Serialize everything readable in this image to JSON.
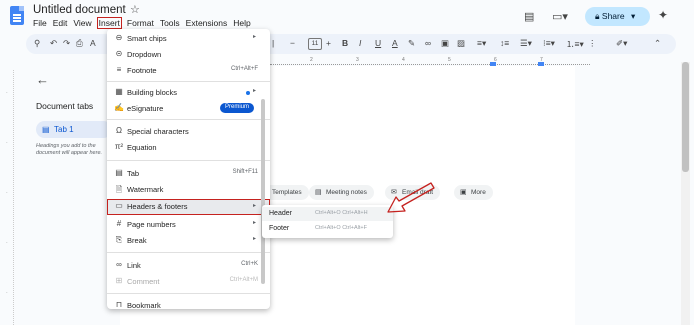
{
  "titlebar": {
    "doc_title": "Untitled document",
    "star_icon": "star-icon",
    "share_label": "Share",
    "share_icon": "lock-icon",
    "right_icons": [
      "comments-icon",
      "meet-icon",
      "gemini-spark-icon"
    ]
  },
  "menubar": {
    "items": [
      "File",
      "Edit",
      "View",
      "Insert",
      "Format",
      "Tools",
      "Extensions",
      "Help"
    ],
    "active": "Insert"
  },
  "toolbar": {
    "font_size": "11",
    "icons": [
      "search-icon",
      "undo-icon",
      "redo-icon",
      "print-icon",
      "spellcheck-icon",
      "decrease-font-size-icon",
      "increase-font-size-icon",
      "bold-icon",
      "italic-icon",
      "underline-icon",
      "text-color-icon",
      "highlight-icon",
      "link-icon",
      "comment-icon",
      "image-icon",
      "align-icon",
      "line-spacing-icon",
      "checklist-icon",
      "bulleted-list-icon",
      "numbered-list-icon",
      "more-icon",
      "pen-icon",
      "collapse-icon"
    ]
  },
  "ruler": {
    "numbers": [
      "1",
      "2",
      "3",
      "4",
      "5",
      "6",
      "7"
    ]
  },
  "sidebar": {
    "tabs_label": "Document tabs",
    "tab_name": "Tab 1",
    "hint": "Headings you add to the document will appear here."
  },
  "page": {
    "chips": [
      {
        "label": "Templates",
        "icon": "templates-icon"
      },
      {
        "label": "Meeting notes",
        "icon": "meeting-notes-icon"
      },
      {
        "label": "Email draft",
        "icon": "email-draft-icon"
      },
      {
        "label": "More",
        "icon": "more-icon"
      }
    ]
  },
  "insert_menu": {
    "items": [
      {
        "label": "Smart chips",
        "icon": "smart-chips-icon",
        "shortcut": "",
        "submenu": true
      },
      {
        "label": "Dropdown",
        "icon": "dropdown-icon",
        "shortcut": "",
        "submenu": false
      },
      {
        "label": "Footnote",
        "icon": "footnote-icon",
        "shortcut": "Ctrl+Alt+F",
        "submenu": false
      },
      {
        "label": "Building blocks",
        "icon": "building-blocks-icon",
        "shortcut": "",
        "submenu": true
      },
      {
        "label": "eSignature",
        "icon": "esignature-icon",
        "badge": "Premium"
      },
      {
        "label": "Special characters",
        "icon": "omega-icon",
        "shortcut": "",
        "submenu": false
      },
      {
        "label": "Equation",
        "icon": "pi-icon",
        "shortcut": "",
        "submenu": false
      },
      {
        "label": "Tab",
        "icon": "tab-icon",
        "shortcut": "Shift+F11",
        "submenu": false
      },
      {
        "label": "Watermark",
        "icon": "watermark-icon",
        "shortcut": "",
        "submenu": false
      },
      {
        "label": "Headers & footers",
        "icon": "header-footer-icon",
        "shortcut": "",
        "submenu": true
      },
      {
        "label": "Page numbers",
        "icon": "hash-icon",
        "shortcut": "",
        "submenu": true
      },
      {
        "label": "Break",
        "icon": "break-icon",
        "shortcut": "",
        "submenu": true
      },
      {
        "label": "Link",
        "icon": "link-icon",
        "shortcut": "Ctrl+K",
        "submenu": false
      },
      {
        "label": "Comment",
        "icon": "comment-icon",
        "shortcut": "Ctrl+Alt+M",
        "submenu": false,
        "disabled": true
      },
      {
        "label": "Bookmark",
        "icon": "bookmark-icon",
        "shortcut": "",
        "submenu": false
      }
    ]
  },
  "submenu": {
    "items": [
      {
        "label": "Header",
        "shortcut": "Ctrl+Alt+O Ctrl+Alt+H"
      },
      {
        "label": "Footer",
        "shortcut": "Ctrl+Alt+O Ctrl+Alt+F"
      }
    ]
  },
  "colors": {
    "accent": "#0b57d0",
    "share_bg": "#c2e7ff",
    "annotation_red": "#c5221f",
    "doc_blue": "#4285f4"
  }
}
